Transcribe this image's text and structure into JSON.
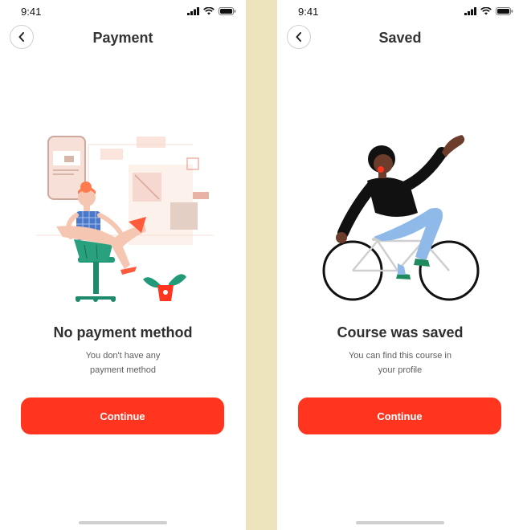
{
  "screens": [
    {
      "status_time": "9:41",
      "title": "Payment",
      "headline": "No payment method",
      "subtext_line1": "You don't have any",
      "subtext_line2": "payment method",
      "button_label": "Continue",
      "illustration": "person-sitting-with-phone-illustration"
    },
    {
      "status_time": "9:41",
      "title": "Saved",
      "headline": "Course was saved",
      "subtext_line1": "You can find this course in",
      "subtext_line2": "your profile",
      "button_label": "Continue",
      "illustration": "person-riding-bicycle-illustration"
    }
  ],
  "colors": {
    "accent": "#ff3520",
    "background_strip": "#ede3bd",
    "title_text": "#333333",
    "body_text": "#5e5e5e"
  },
  "icons": [
    "back-arrow-icon",
    "signal-icon",
    "wifi-icon",
    "battery-icon"
  ]
}
